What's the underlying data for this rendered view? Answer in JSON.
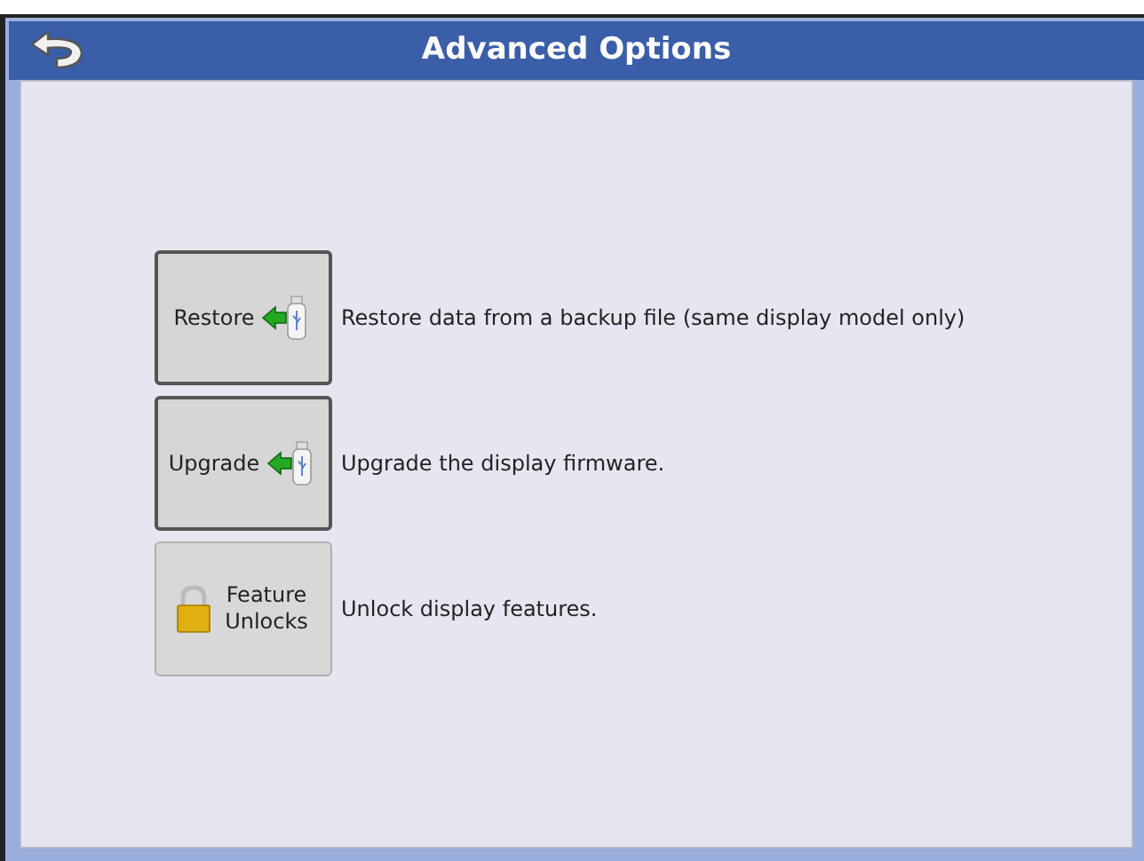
{
  "header": {
    "title": "Advanced Options"
  },
  "options": [
    {
      "label": "Restore",
      "kind": "usb",
      "disabled": false,
      "description": "Restore data from a backup file (same display model only)"
    },
    {
      "label": "Upgrade",
      "kind": "usb",
      "disabled": false,
      "description": "Upgrade the display firmware."
    },
    {
      "label": "Feature Unlocks",
      "kind": "lock",
      "disabled": true,
      "description": "Unlock display features."
    }
  ]
}
